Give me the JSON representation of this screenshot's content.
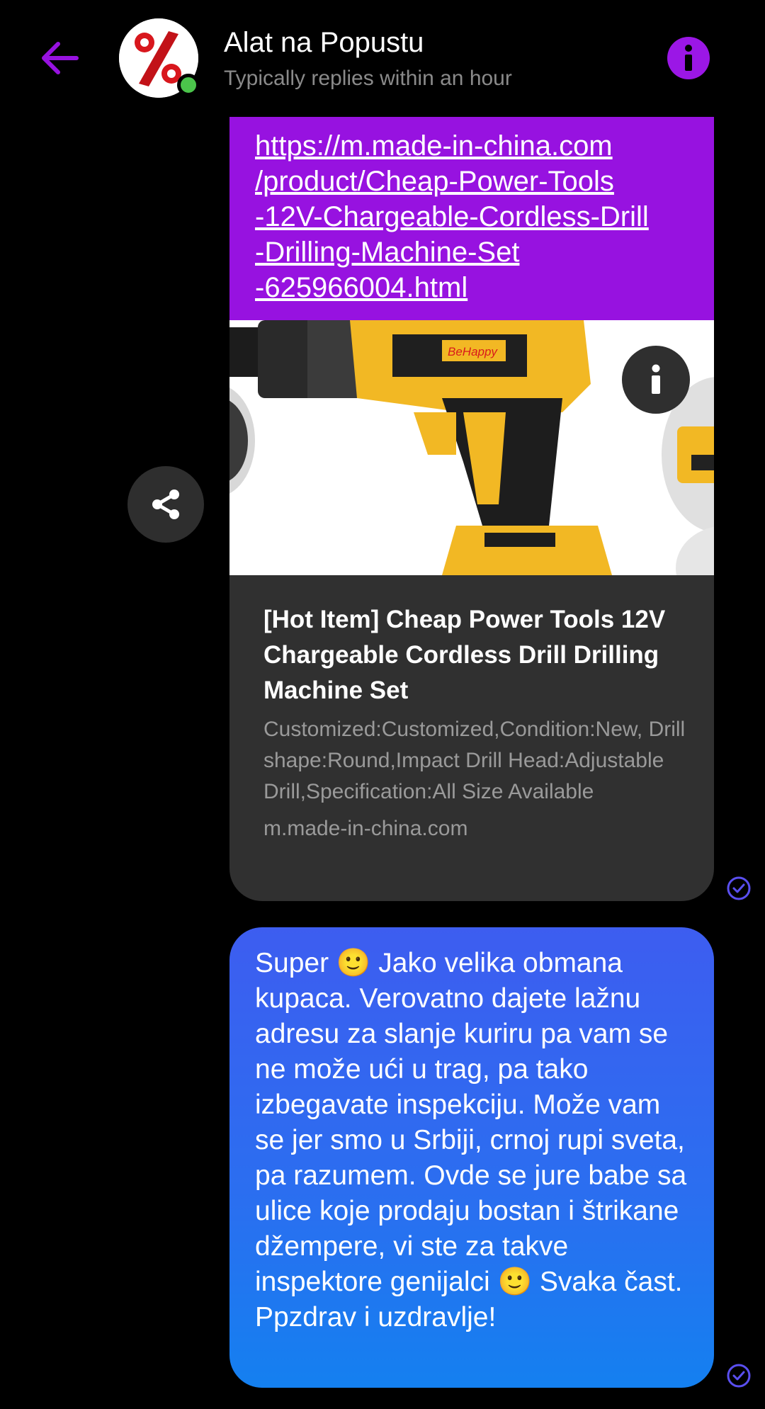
{
  "header": {
    "contact_name": "Alat na Popustu",
    "status": "Typically replies within an hour",
    "avatar_glyph": "%"
  },
  "link_message": {
    "url": "https://m.made-in-china.com/product/Cheap-Power-Tools-12V-Chargeable-Cordless-Drill-Drilling-Machine-Set-625966004.html",
    "url_lines": [
      "https://m.made-in-china.com",
      "/product/Cheap-Power-Tools",
      "-12V-Chargeable-Cordless-Drill",
      "-Drilling-Machine-Set",
      "-625966004.html"
    ],
    "preview_brand_label": "BeHappy",
    "preview_title": "[Hot Item] Cheap Power Tools 12V Chargeable Cordless Drill Drilling Machine Set",
    "preview_description": "Customized:Customized,Condition:New, Drill shape:Round,Impact Drill Head:Adjustable Drill,Specification:All Size Available",
    "preview_domain": "m.made-in-china.com"
  },
  "text_message": {
    "text": "Super 🙂 Jako velika obmana kupaca. Verovatno dajete lažnu adresu za slanje kuriru pa vam se ne može ući u trag, pa tako izbegavate inspekciju. Može vam se jer smo u Srbiji, crnoj rupi sveta, pa razumem. Ovde se jure babe sa ulice koje prodaju bostan i štrikane džempere, vi ste za takve inspektore genijalci 🙂 Svaka čast. Ppzdrav i uzdravlje!"
  },
  "colors": {
    "accent": "#9712e0",
    "bubble_gradient_top": "#3d5df0",
    "bubble_gradient_bottom": "#1480f0",
    "online": "#4bc44b"
  },
  "icons": {
    "back": "arrow-left-icon",
    "info": "info-icon",
    "share": "share-icon",
    "seen": "check-circle-icon"
  }
}
